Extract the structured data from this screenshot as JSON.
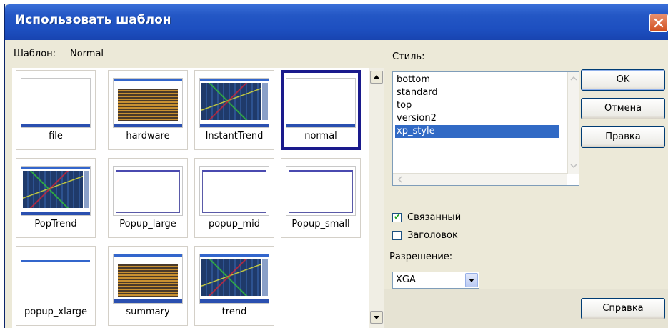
{
  "dialog": {
    "title": "Использовать шаблон"
  },
  "template": {
    "label": "Шаблон:",
    "current": "Normal",
    "tiles": [
      {
        "name": "file",
        "thumb": "blank-bar"
      },
      {
        "name": "hardware",
        "thumb": "bars"
      },
      {
        "name": "InstantTrend",
        "thumb": "trend"
      },
      {
        "name": "normal",
        "thumb": "blank-bar",
        "selected": true
      },
      {
        "name": "PopTrend",
        "thumb": "trend"
      },
      {
        "name": "Popup_large",
        "thumb": "frame"
      },
      {
        "name": "popup_mid",
        "thumb": "frame"
      },
      {
        "name": "Popup_small",
        "thumb": "frame"
      },
      {
        "name": "popup_xlarge",
        "thumb": "topline"
      },
      {
        "name": "summary",
        "thumb": "bars"
      },
      {
        "name": "trend",
        "thumb": "trend"
      }
    ]
  },
  "style": {
    "label": "Стиль:",
    "items": [
      "bottom",
      "standard",
      "top",
      "version2",
      "xp_style"
    ],
    "selected": "xp_style"
  },
  "options": {
    "linked_label": "Связанный",
    "linked_checked": true,
    "header_label": "Заголовок",
    "header_checked": false
  },
  "resolution": {
    "label": "Разрешение:",
    "value": "XGA"
  },
  "buttons": {
    "ok": "OK",
    "cancel": "Отмена",
    "edit": "Правка",
    "help": "Справка"
  },
  "colors": {
    "titlebar": "#1d4fc0",
    "selection": "#316ac5",
    "tile_selected_border": "#1a1a8c",
    "dialog_bg": "#ece9d8"
  }
}
